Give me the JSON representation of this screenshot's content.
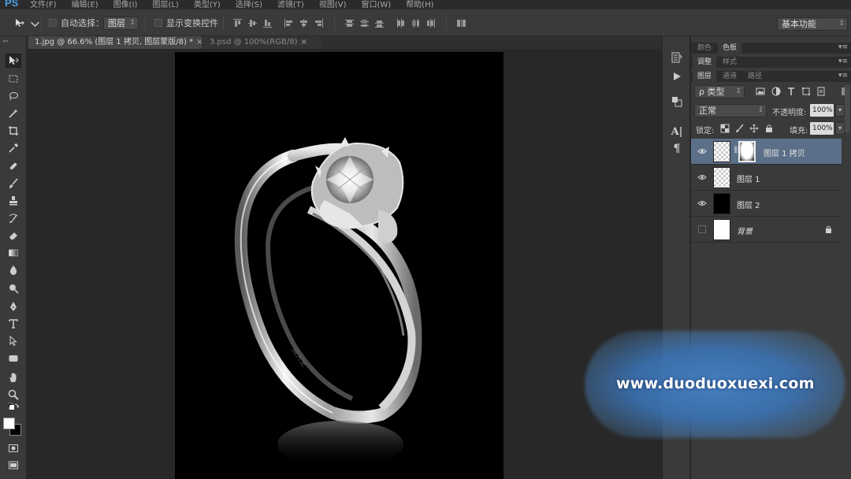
{
  "app": {
    "logo": "PS"
  },
  "menu": [
    "文件(F)",
    "编辑(E)",
    "图像(I)",
    "图层(L)",
    "类型(Y)",
    "选择(S)",
    "滤镜(T)",
    "视图(V)",
    "窗口(W)",
    "帮助(H)"
  ],
  "options": {
    "auto_select_label": "自动选择：",
    "auto_select_target": "图层",
    "show_transform_label": "显示变换控件",
    "workspace": "基本功能"
  },
  "tabs": [
    {
      "label": "1.jpg @ 66.6% (图层 1 拷贝, 图层蒙版/8) *",
      "close": "×"
    },
    {
      "label": "3.psd @ 100%(RGB/8)",
      "close": "×"
    }
  ],
  "panels": {
    "top_tabs": [
      "颜色",
      "色板"
    ],
    "mid_tabs": [
      "调整",
      "样式"
    ],
    "layer_tabs": [
      "图层",
      "通道",
      "路径"
    ],
    "menu_glyph": "▾≡"
  },
  "layers_panel": {
    "filter_kind": "ρ 类型",
    "blend_mode": "正常",
    "opacity_label": "不透明度:",
    "opacity_value": "100%",
    "lock_label": "锁定:",
    "fill_label": "填充:",
    "fill_value": "100%",
    "layers": [
      {
        "name": "图层 1 拷贝",
        "visible": true,
        "selected": true,
        "has_mask": true
      },
      {
        "name": "图层 1",
        "visible": true,
        "selected": false,
        "has_mask": false
      },
      {
        "name": "图层 2",
        "visible": true,
        "selected": false,
        "has_mask": false
      },
      {
        "name": "背景",
        "visible": false,
        "selected": false,
        "locked": true
      }
    ]
  },
  "dock": {
    "char_icon": "A|",
    "para_icon": "¶"
  },
  "watermark": "www.duoduoxuexi.com",
  "colors": {
    "accent_selection": "#5b6f88",
    "watermark_blue": "#3c78be",
    "ps_blue": "#4aa0e6"
  }
}
